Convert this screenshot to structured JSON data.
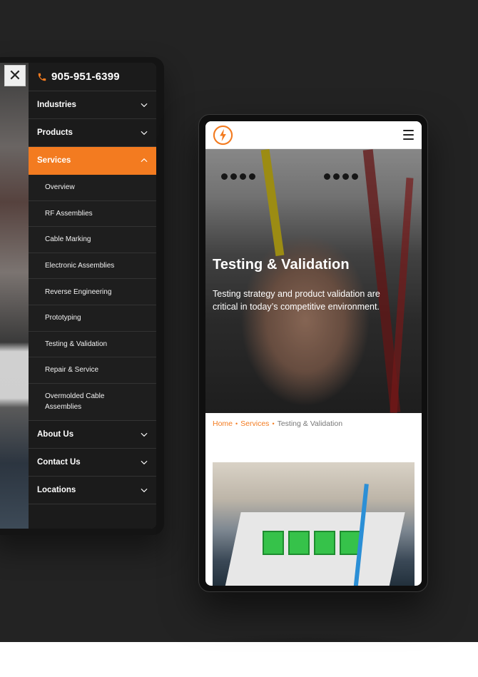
{
  "left_device": {
    "close_label": "✕",
    "phone_number": "905-951-6399",
    "menu": {
      "items_top": [
        {
          "label": "Industries"
        },
        {
          "label": "Products"
        }
      ],
      "active": {
        "label": "Services"
      },
      "sub_items": [
        {
          "label": "Overview"
        },
        {
          "label": "RF Assemblies"
        },
        {
          "label": "Cable Marking"
        },
        {
          "label": "Electronic Assemblies"
        },
        {
          "label": "Reverse Engineering"
        },
        {
          "label": "Prototyping"
        },
        {
          "label": "Testing & Validation"
        },
        {
          "label": "Repair & Service"
        },
        {
          "label": "Overmolded Cable Assemblies"
        }
      ],
      "items_bottom": [
        {
          "label": "About Us"
        },
        {
          "label": "Contact Us"
        },
        {
          "label": "Locations"
        }
      ]
    }
  },
  "right_device": {
    "hero": {
      "title": "Testing & Validation",
      "text": "Testing strategy and product validation are critical in today’s competitive environment."
    },
    "breadcrumb": {
      "home": "Home",
      "services": "Services",
      "current": "Testing & Validation",
      "separator": "•"
    }
  },
  "colors": {
    "accent": "#f37b20",
    "menu_bg": "#1b1b1b",
    "page_bg": "#232323"
  }
}
